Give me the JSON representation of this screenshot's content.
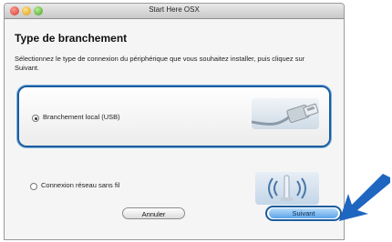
{
  "window": {
    "title": "Start Here OSX"
  },
  "page": {
    "heading": "Type de branchement",
    "instructions": "Sélectionnez le type de connexion du périphérique que vous souhaitez installer, puis cliquez sur Suivant."
  },
  "options": [
    {
      "label": "Branchement local (USB)",
      "selected": true,
      "icon": "usb-cable-icon"
    },
    {
      "label": "Connexion réseau sans fil",
      "selected": false,
      "icon": "wireless-network-icon"
    }
  ],
  "buttons": {
    "cancel": "Annuler",
    "next": "Suivant"
  },
  "colors": {
    "highlight": "#1a5d9e",
    "arrow": "#1f66c0"
  }
}
